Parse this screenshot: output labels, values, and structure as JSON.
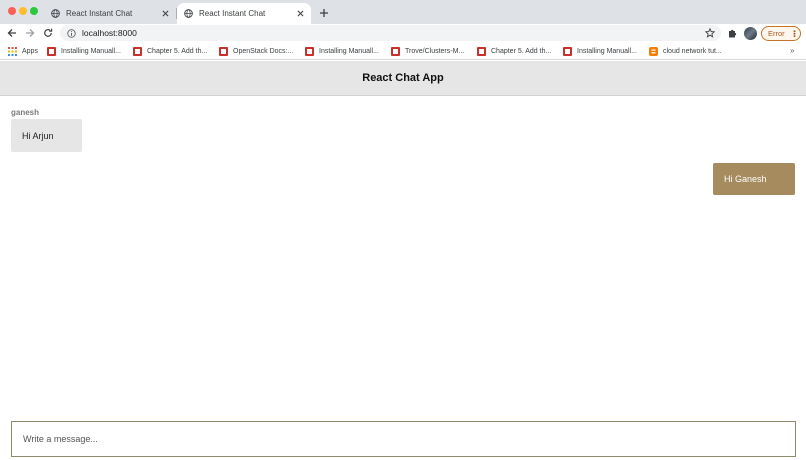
{
  "browser": {
    "tabs": [
      {
        "title": "React Instant Chat",
        "active": false
      },
      {
        "title": "React Instant Chat",
        "active": true
      }
    ],
    "url": "localhost:8000",
    "error_label": "Error",
    "bookmarks": [
      {
        "label": "Apps",
        "icon": "apps-grid-icon"
      },
      {
        "label": "Installing Manuall...",
        "icon": "redhat-icon"
      },
      {
        "label": "Chapter 5. Add th...",
        "icon": "redhat-icon"
      },
      {
        "label": "OpenStack Docs:...",
        "icon": "redhat-icon"
      },
      {
        "label": "Installing Manuall...",
        "icon": "redhat-icon"
      },
      {
        "label": "Trove/Clusters-M...",
        "icon": "redhat-icon"
      },
      {
        "label": "Chapter 5. Add th...",
        "icon": "redhat-icon"
      },
      {
        "label": "Installing Manuall...",
        "icon": "redhat-icon"
      },
      {
        "label": "cloud network tut...",
        "icon": "blogger-icon"
      }
    ],
    "more_bookmarks": "»"
  },
  "app": {
    "title": "React Chat App",
    "messages": [
      {
        "sender": "ganesh",
        "text": "Hi Arjun",
        "direction": "received"
      },
      {
        "sender": "",
        "text": "Hi Ganesh",
        "direction": "sent"
      }
    ],
    "composer_placeholder": "Write a message..."
  },
  "colors": {
    "header_bg": "#e6e6e6",
    "received_bubble": "#e6e6e6",
    "sent_bubble": "#a58b5e",
    "composer_border": "#8f8a6c",
    "error_accent": "#c5742a"
  }
}
